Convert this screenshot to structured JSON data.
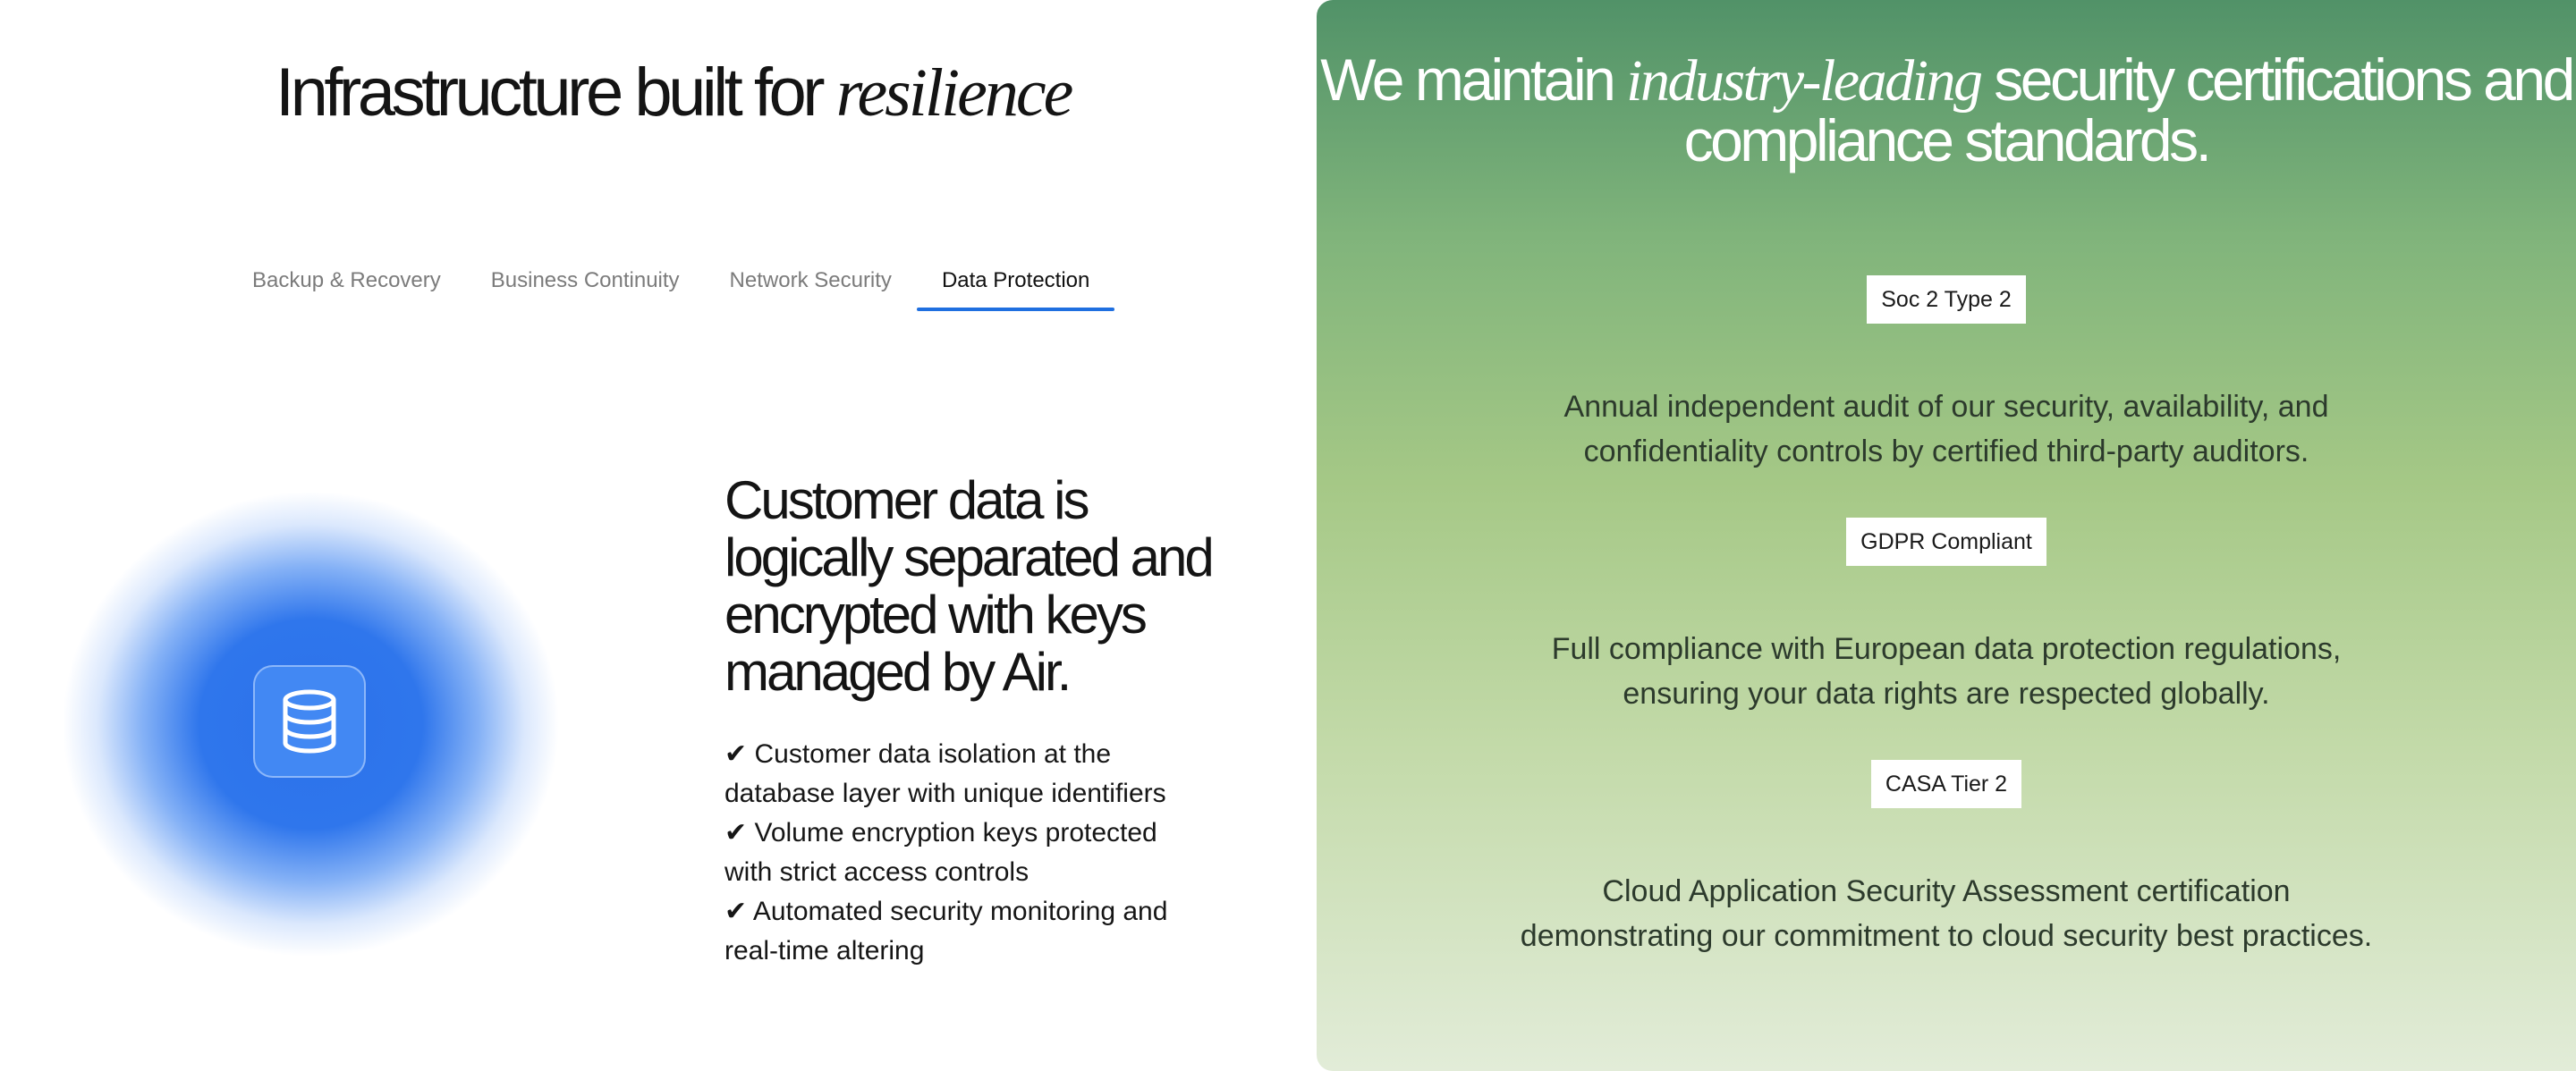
{
  "left": {
    "heading": {
      "main": "Infrastructure built for ",
      "emphasis": "resilience"
    },
    "tabs": [
      {
        "label": "Backup & Recovery",
        "active": false
      },
      {
        "label": "Business Continuity",
        "active": false
      },
      {
        "label": "Network Security",
        "active": false
      },
      {
        "label": "Data Protection",
        "active": true
      }
    ],
    "feature": {
      "icon": "database-icon",
      "heading": "Customer data is logically separated and encrypted with keys managed by Air.",
      "items": [
        "✔ Customer data isolation at the database layer with unique identifiers",
        "✔ Volume encryption keys protected with strict access controls",
        "✔ Automated security monitoring and real-time altering"
      ]
    }
  },
  "panel": {
    "heading": {
      "before": "We maintain ",
      "emphasis": "industry-leading",
      "after": " security certifications and compliance standards."
    },
    "certifications": [
      {
        "badge": "Soc 2 Type 2",
        "description": "Annual independent audit of our security, availability, and confidentiality controls by certified third-party auditors."
      },
      {
        "badge": "GDPR Compliant",
        "description": "Full compliance with European data protection regulations, ensuring your data rights are respected globally."
      },
      {
        "badge": "CASA Tier 2",
        "description": "Cloud Application Security Assessment certification demonstrating our commitment to cloud security best practices."
      }
    ]
  },
  "colors": {
    "tab_underline": "#1f6fe0",
    "glow_blue": "#2b72ea",
    "panel_top": "#519268",
    "panel_bottom": "#e2ecd8"
  }
}
